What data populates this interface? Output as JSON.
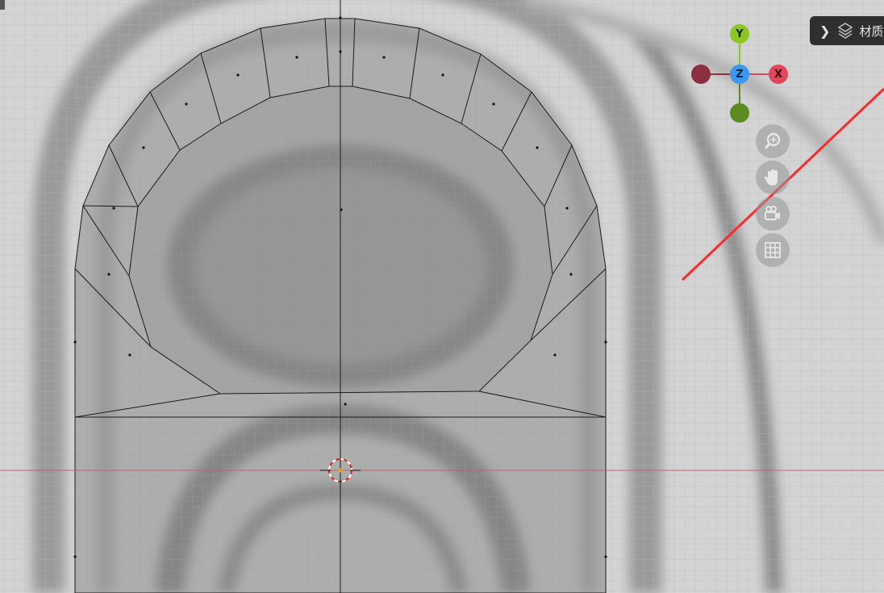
{
  "header_tab": {
    "label": "材质",
    "chevron_icon": "chevron-right-icon",
    "material_icon": "material-icon"
  },
  "gizmo": {
    "y_label": "Y",
    "z_label": "Z",
    "x_label": "X",
    "colors": {
      "x": "#e2465a",
      "x_neg": "#8a3040",
      "y": "#8dc521",
      "y_neg": "#5d8b22",
      "z": "#3b98f0"
    }
  },
  "nav_buttons": [
    {
      "icon": "zoom-icon"
    },
    {
      "icon": "hand-pan-icon"
    },
    {
      "icon": "camera-icon"
    },
    {
      "icon": "grid-icon"
    }
  ],
  "colors": {
    "viewport_bg": "#c9c9c9",
    "grid_minor": "#b9b9b9",
    "mesh_fill": "#8f8f8f",
    "x_axis_line": "#d64a56",
    "annotation_line": "#ff2a2a"
  }
}
